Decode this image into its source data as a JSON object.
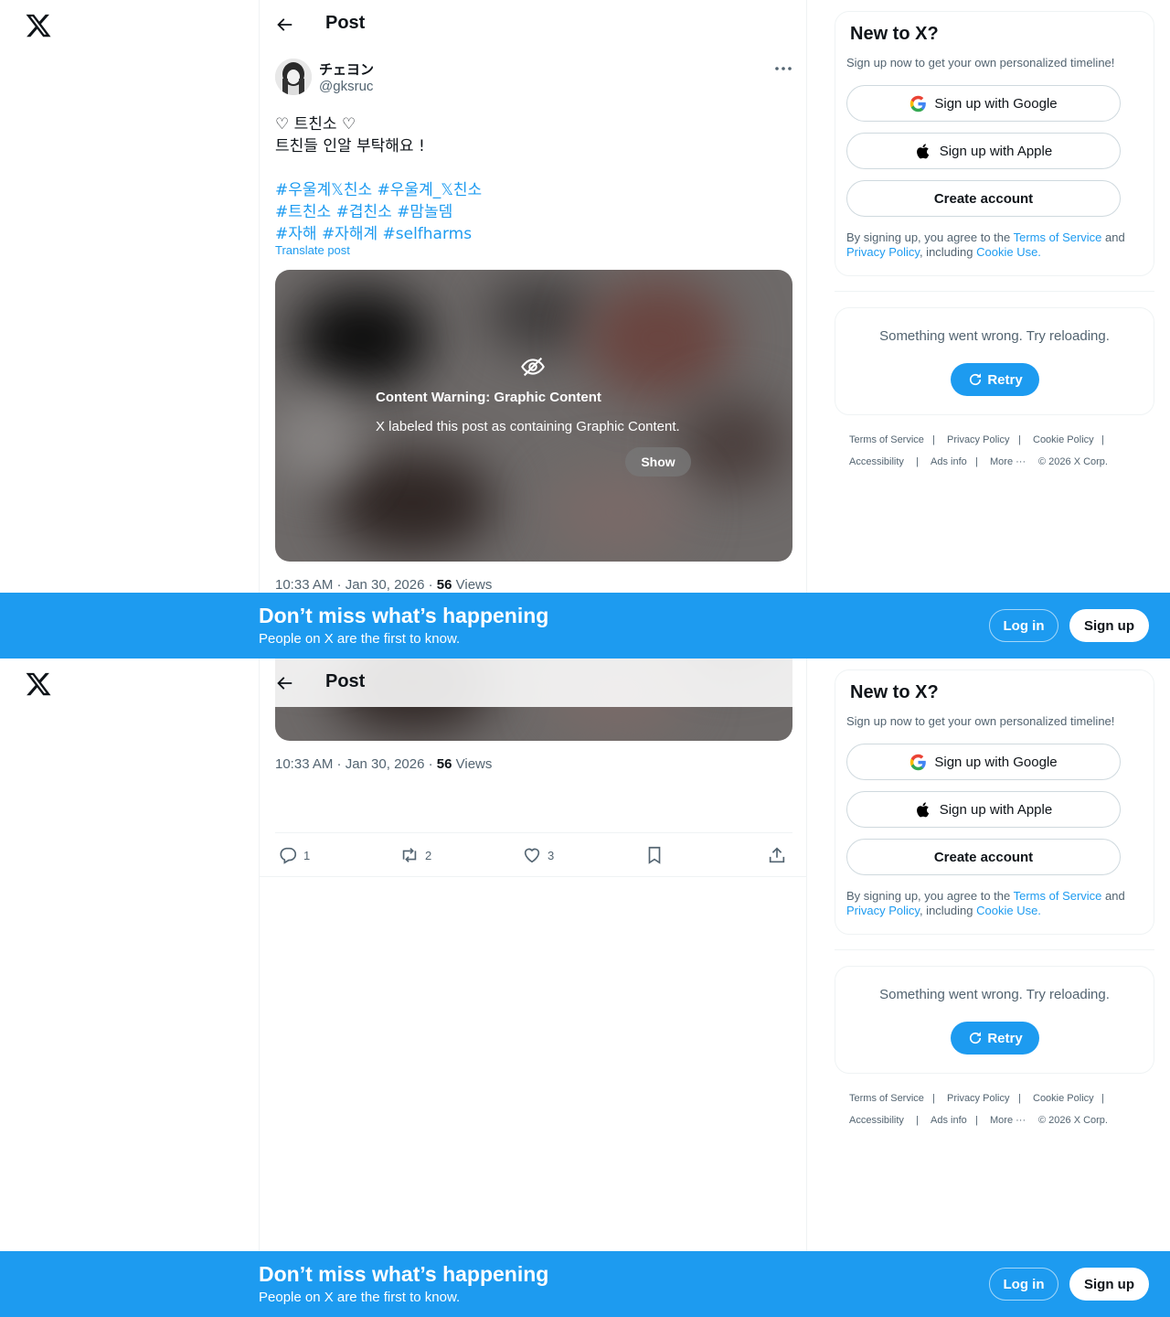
{
  "header": {
    "title": "Post"
  },
  "post": {
    "display_name": "チェヨン",
    "handle": "@gksruc",
    "text_lines": [
      "♡ 트친소 ♡",
      "트친들 인알 부탁해요 !"
    ],
    "hashtag_lines": [
      [
        "#우울계𝕏친소",
        "#우울계_𝕏친소"
      ],
      [
        "#트친소",
        "#겹친소",
        "#맘놀뎀"
      ],
      [
        "#자해",
        "#자해계",
        "#selfharms"
      ]
    ],
    "translate_label": "Translate post",
    "media": {
      "warning_title": "Content Warning: Graphic Content",
      "warning_text": "X labeled this post as containing Graphic Content.",
      "show_label": "Show"
    },
    "timestamp": "10:33 AM · Jan 30, 2026 · ",
    "views_count": "56",
    "views_label": " Views",
    "actions": {
      "replies": "1",
      "reposts": "2",
      "likes": "3"
    }
  },
  "sidebar": {
    "signup": {
      "title": "New to X?",
      "subtitle": "Sign up now to get your own personalized timeline!",
      "google_label": "Sign up with Google",
      "apple_label": "Sign up with Apple",
      "create_label": "Create account",
      "legal_prefix": "By signing up, you agree to the ",
      "terms_link": "Terms of Service",
      "legal_and": " and ",
      "privacy_link": "Privacy Policy",
      "legal_including": ", including ",
      "cookie_link": "Cookie Use."
    },
    "error": {
      "text": "Something went wrong. Try reloading.",
      "retry_label": "Retry"
    },
    "footer": {
      "terms": "Terms of Service",
      "privacy": "Privacy Policy",
      "cookie": "Cookie Policy",
      "accessibility": "Accessibility",
      "ads": "Ads info",
      "more": "More ···",
      "copyright": "© 2026 X Corp."
    }
  },
  "banner": {
    "title": "Don’t miss what’s happening",
    "subtitle": "People on X are the first to know.",
    "login_label": "Log in",
    "signup_label": "Sign up"
  },
  "colors": {
    "accent": "#1d9bf0",
    "text": "#0f1419",
    "muted": "#536471",
    "border": "#eff3f4"
  }
}
